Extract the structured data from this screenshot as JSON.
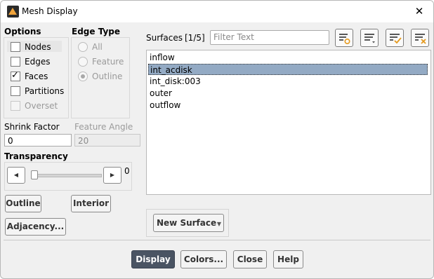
{
  "window": {
    "title": "Mesh Display"
  },
  "options": {
    "heading": "Options",
    "nodes": {
      "label": "Nodes",
      "checked": false
    },
    "edges": {
      "label": "Edges",
      "checked": false
    },
    "faces": {
      "label": "Faces",
      "checked": true
    },
    "partitions": {
      "label": "Partitions",
      "checked": false
    },
    "overset": {
      "label": "Overset",
      "checked": false,
      "disabled": true
    }
  },
  "edge_type": {
    "heading": "Edge Type",
    "all": "All",
    "feature": "Feature",
    "outline": "Outline",
    "selected": "Outline"
  },
  "shrink": {
    "label": "Shrink Factor",
    "value": "0"
  },
  "feature_angle": {
    "label": "Feature Angle",
    "value": "20"
  },
  "transparency": {
    "label": "Transparency",
    "value": "0"
  },
  "buttons": {
    "outline": "Outline",
    "interior": "Interior",
    "adjacency": "Adjacency...",
    "new_surface": "New Surface",
    "display": "Display",
    "colors": "Colors...",
    "close": "Close",
    "help": "Help"
  },
  "surfaces": {
    "label": "Surfaces",
    "count": "[1/5]",
    "filter_placeholder": "Filter Text",
    "items": [
      "inflow",
      "int_acdisk",
      "int_disk:003",
      "outer",
      "outflow"
    ],
    "selected": "int_acdisk"
  },
  "colors": {
    "primary_button": "#4a5463",
    "selection": "#93aac4"
  }
}
